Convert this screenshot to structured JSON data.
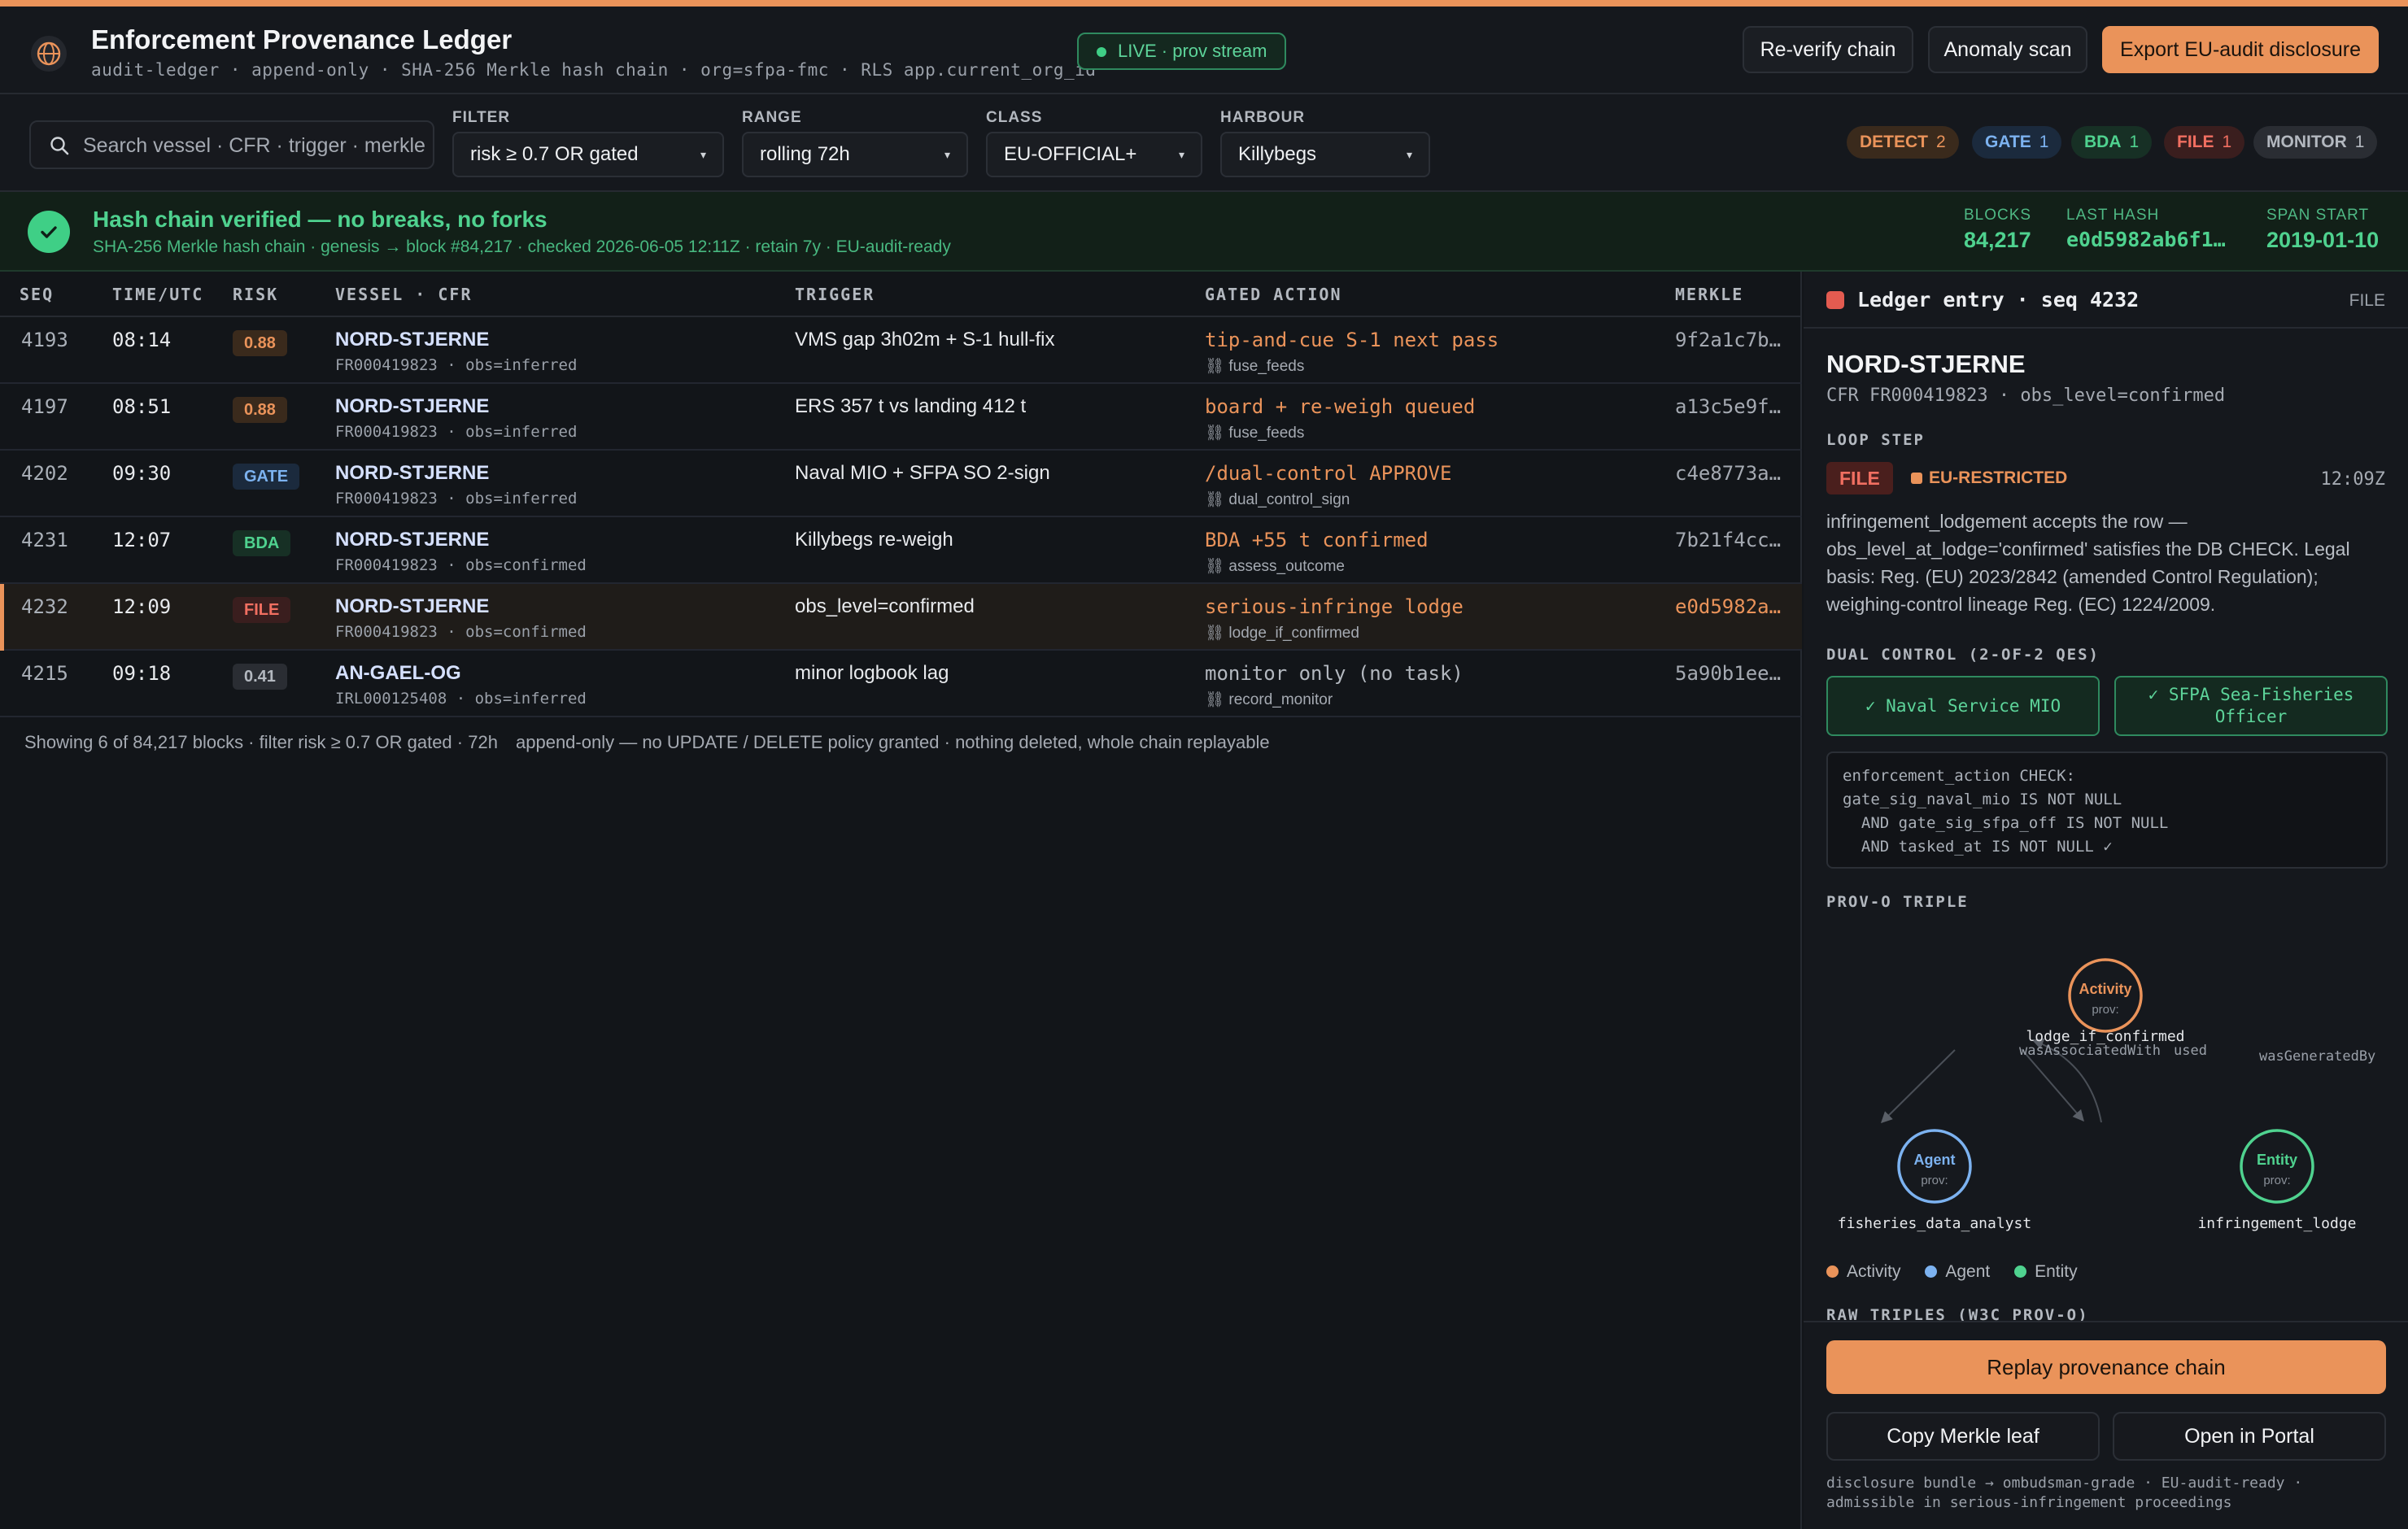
{
  "header": {
    "title": "Enforcement Provenance Ledger",
    "subtitle": "audit-ledger · append-only · SHA-256 Merkle hash chain · org=sfpa-fmc · RLS app.current_org_id",
    "live_label": "LIVE · prov stream",
    "buttons": {
      "reverify": "Re-verify chain",
      "anomaly": "Anomaly scan",
      "export": "Export EU-audit disclosure"
    }
  },
  "filters": {
    "search_placeholder": "Search vessel · CFR · trigger · merkle",
    "filter": {
      "label": "FILTER",
      "value": "risk ≥ 0.7 OR gated"
    },
    "range": {
      "label": "RANGE",
      "value": "rolling 72h"
    },
    "class": {
      "label": "CLASS",
      "value": "EU-OFFICIAL+"
    },
    "harbour": {
      "label": "HARBOUR",
      "value": "Killybegs"
    },
    "pills": [
      {
        "label": "DETECT",
        "count": "2",
        "bg": "#3a2a1c",
        "fg": "#ea935a"
      },
      {
        "label": "GATE",
        "count": "1",
        "bg": "#1b2a3d",
        "fg": "#7cb2f0"
      },
      {
        "label": "BDA",
        "count": "1",
        "bg": "#173025",
        "fg": "#4fd28f"
      },
      {
        "label": "FILE",
        "count": "1",
        "bg": "#3a1e1e",
        "fg": "#f16f61"
      },
      {
        "label": "MONITOR",
        "count": "1",
        "bg": "#2a2d33",
        "fg": "#b3b8bf"
      }
    ]
  },
  "banner": {
    "title": "Hash chain verified — no breaks, no forks",
    "subtitle": "SHA-256 Merkle hash chain · genesis → block #84,217 · checked 2026-06-05 12:11Z · retain 7y · EU-audit-ready",
    "stats": [
      {
        "label": "BLOCKS",
        "value": "84,217"
      },
      {
        "label": "LAST HASH",
        "value": "e0d5982ab6f1…"
      },
      {
        "label": "SPAN START",
        "value": "2019-01-10"
      }
    ]
  },
  "table": {
    "columns": {
      "seq": "SEQ",
      "time": "TIME/UTC",
      "risk": "RISK",
      "vessel": "VESSEL · CFR",
      "trigger": "TRIGGER",
      "action": "GATED ACTION",
      "merkle": "MERKLE"
    },
    "rows": [
      {
        "seq": "4193",
        "time": "08:14",
        "risk": "0.88",
        "vessel": "NORD-STJERNE",
        "cfr": "FR000419823 · obs=inferred",
        "trigger": "VMS gap 3h02m + S-1 hull-fix",
        "action": "tip-and-cue S-1 next pass",
        "action_sub": "⛓ fuse_feeds",
        "merkle": "9f2a1c7b…"
      },
      {
        "seq": "4197",
        "time": "08:51",
        "risk": "0.88",
        "vessel": "NORD-STJERNE",
        "cfr": "FR000419823 · obs=inferred",
        "trigger": "ERS 357 t vs landing 412 t",
        "action": "board + re-weigh queued",
        "action_sub": "⛓ fuse_feeds",
        "merkle": "a13c5e9f…"
      },
      {
        "seq": "4202",
        "time": "09:30",
        "risk": "GATE",
        "vessel": "NORD-STJERNE",
        "cfr": "FR000419823 · obs=inferred",
        "trigger": "Naval MIO + SFPA SO 2-sign",
        "action": "/dual-control APPROVE",
        "action_sub": "⛓ dual_control_sign",
        "merkle": "c4e8773a…"
      },
      {
        "seq": "4231",
        "time": "12:07",
        "risk": "BDA",
        "vessel": "NORD-STJERNE",
        "cfr": "FR000419823 · obs=confirmed",
        "trigger": "Killybegs re-weigh",
        "action": "BDA +55 t confirmed",
        "action_sub": "⛓ assess_outcome",
        "merkle": "7b21f4cc…"
      },
      {
        "seq": "4232",
        "time": "12:09",
        "risk": "FILE",
        "vessel": "NORD-STJERNE",
        "cfr": "FR000419823 · obs=confirmed",
        "trigger": "obs_level=confirmed",
        "action": "serious-infringe lodge",
        "action_sub": "⛓ lodge_if_confirmed",
        "merkle": "e0d5982a…"
      },
      {
        "seq": "4215",
        "time": "09:18",
        "risk": "0.41",
        "vessel": "AN-GAEL-OG",
        "cfr": "IRL000125408 · obs=inferred",
        "trigger": "minor logbook lag",
        "action": "monitor only (no task)",
        "action_sub": "⛓ record_monitor",
        "merkle": "5a90b1ee…"
      }
    ],
    "footer_left": "Showing 6 of 84,217 blocks · filter risk ≥ 0.7 OR gated · 72h",
    "footer_right": "append-only — no UPDATE / DELETE policy granted · nothing deleted, whole chain replayable"
  },
  "panel": {
    "title": "Ledger entry · seq 4232",
    "kind": "FILE",
    "vessel": "NORD-STJERNE",
    "cfr": "CFR FR000419823 · obs_level=confirmed",
    "loop_step_label": "LOOP STEP",
    "step_badge": "FILE",
    "classification": "EU-RESTRICTED",
    "time": "12:09Z",
    "body": "infringement_lodgement accepts the row — obs_level_at_lodge='confirmed' satisfies the DB CHECK. Legal basis: Reg. (EU) 2023/2842 (amended Control Regulation); weighing-control lineage Reg. (EC) 1224/2009.",
    "dual_label": "DUAL CONTROL (2-OF-2 QES)",
    "sig1": "✓ Naval Service MIO",
    "sig2": "✓ SFPA Sea-Fisheries Officer",
    "code": "enforcement_action CHECK:\ngate_sig_naval_mio IS NOT NULL\n  AND gate_sig_sfpa_off IS NOT NULL\n  AND tasked_at IS NOT NULL ✓",
    "prov_label": "PROV-O TRIPLE",
    "graph": {
      "activity": {
        "title": "Activity",
        "sub": "prov:",
        "label": "lodge_if_confirmed"
      },
      "agent": {
        "title": "Agent",
        "sub": "prov:",
        "label": "fisheries_data_analyst"
      },
      "entity": {
        "title": "Entity",
        "sub": "prov:",
        "label": "infringement_lodge"
      },
      "edge_assoc": "wasAssociatedWith",
      "edge_used": "used",
      "edge_gen": "wasGeneratedBy"
    },
    "legend": {
      "activity": "Activity",
      "agent": "Agent",
      "entity": "Entity"
    },
    "raw_label": "RAW TRIPLES (W3C PROV-O)",
    "replay": "Replay provenance chain",
    "copy": "Copy Merkle leaf",
    "portal": "Open in Portal",
    "note": "disclosure bundle → ombudsman-grade · EU-audit-ready · admissible in serious-infringement proceedings"
  },
  "colors": {
    "accent": "#ea935a",
    "ok": "#4fd28f",
    "danger": "#f16f61",
    "info": "#7cb2f0"
  }
}
